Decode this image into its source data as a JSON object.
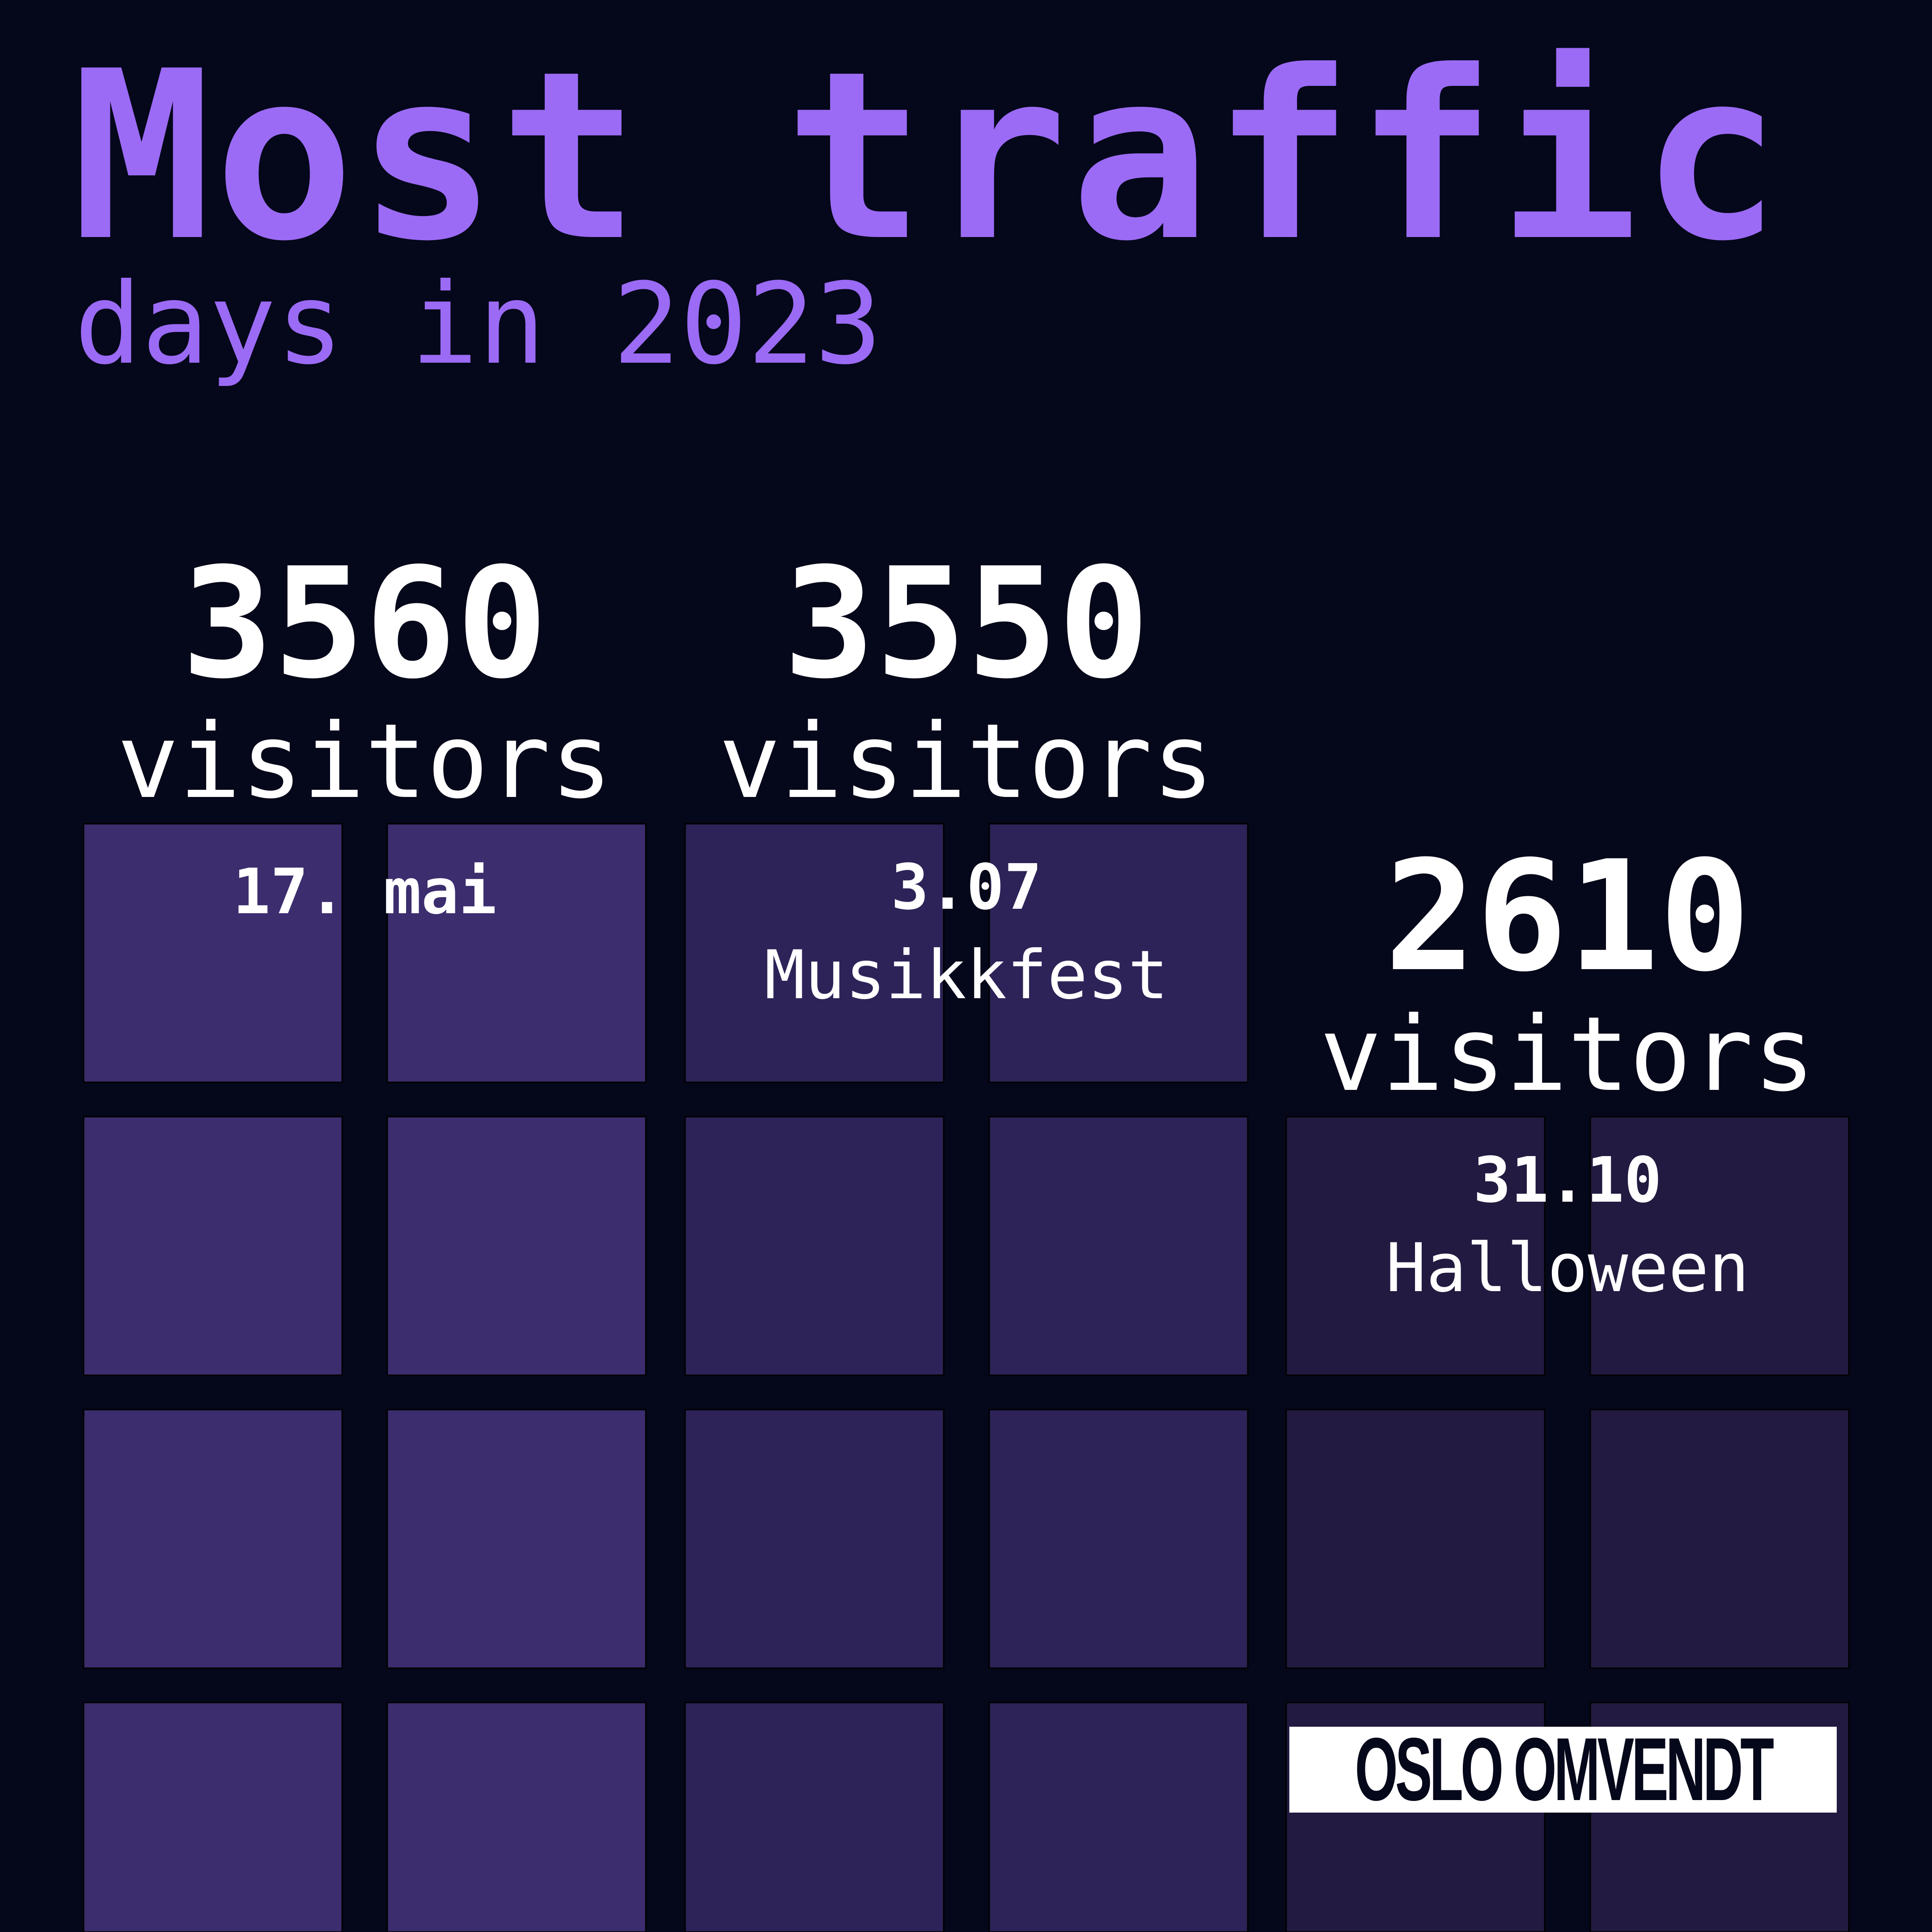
{
  "header": {
    "title": "Most traffic",
    "subtitle": "days in 2023"
  },
  "colors": {
    "background": "#05071a",
    "accent": "#9b6bf5",
    "text": "#ffffff",
    "cell_first": "#3b2d6e",
    "cell_second": "#2d2358",
    "cell_third": "#221a40"
  },
  "chart_data": {
    "type": "bar",
    "categories": [
      "17. mai",
      "3.07 Musikkfest",
      "31.10 Halloween"
    ],
    "values": [
      3560,
      3550,
      2610
    ],
    "bars": [
      {
        "value": 3560,
        "value_label": "3560",
        "unit": "visitors",
        "date": "17. mai",
        "event": "",
        "color": "#3b2d6e"
      },
      {
        "value": 3550,
        "value_label": "3550",
        "unit": "visitors",
        "date": "3.07",
        "event": "Musikkfest",
        "color": "#2d2358"
      },
      {
        "value": 2610,
        "value_label": "2610",
        "unit": "visitors",
        "date": "31.10",
        "event": "Halloween",
        "color": "#221a40"
      }
    ],
    "title": "",
    "xlabel": "",
    "ylabel": ""
  },
  "brand": {
    "logo_text": "OSLO OMVENDT"
  }
}
